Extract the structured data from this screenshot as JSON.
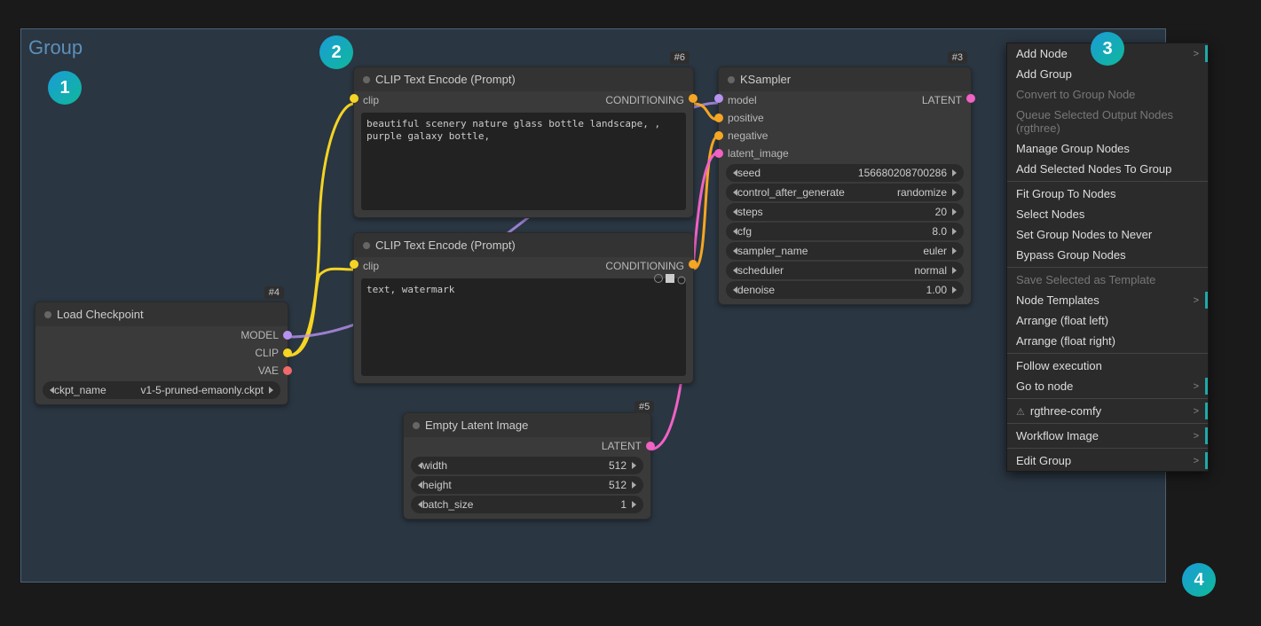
{
  "group": {
    "title": "Group"
  },
  "nodes": {
    "loadckpt": {
      "id": "#4",
      "title": "Load Checkpoint",
      "outputs": {
        "model": "MODEL",
        "clip": "CLIP",
        "vae": "VAE"
      },
      "widget": {
        "label": "ckpt_name",
        "value": "v1-5-pruned-emaonly.ckpt"
      }
    },
    "clip1": {
      "id": "#6",
      "title": "CLIP Text Encode (Prompt)",
      "in": "clip",
      "out": "CONDITIONING",
      "text": "beautiful scenery nature glass bottle landscape, , purple galaxy bottle,"
    },
    "clip2": {
      "id": "",
      "title": "CLIP Text Encode (Prompt)",
      "in": "clip",
      "out": "CONDITIONING",
      "text": "text, watermark"
    },
    "empty": {
      "id": "#5",
      "title": "Empty Latent Image",
      "out": "LATENT",
      "widgets": [
        {
          "label": "width",
          "value": "512"
        },
        {
          "label": "height",
          "value": "512"
        },
        {
          "label": "batch_size",
          "value": "1"
        }
      ]
    },
    "ksampler": {
      "id": "#3",
      "title": "KSampler",
      "ins": {
        "model": "model",
        "positive": "positive",
        "negative": "negative",
        "latent": "latent_image"
      },
      "out": "LATENT",
      "widgets": [
        {
          "label": "seed",
          "value": "156680208700286"
        },
        {
          "label": "control_after_generate",
          "value": "randomize"
        },
        {
          "label": "steps",
          "value": "20"
        },
        {
          "label": "cfg",
          "value": "8.0"
        },
        {
          "label": "sampler_name",
          "value": "euler"
        },
        {
          "label": "scheduler",
          "value": "normal"
        },
        {
          "label": "denoise",
          "value": "1.00"
        }
      ]
    }
  },
  "menu": {
    "items": [
      {
        "label": "Add Node",
        "sub": true,
        "accent": true
      },
      {
        "label": "Add Group"
      },
      {
        "label": "Convert to Group Node",
        "disabled": true
      },
      {
        "label": "Queue Selected Output Nodes (rgthree)",
        "disabled": true
      },
      {
        "label": "Manage Group Nodes"
      },
      {
        "label": "Add Selected Nodes To Group"
      },
      {
        "sep": true
      },
      {
        "label": "Fit Group To Nodes"
      },
      {
        "label": "Select Nodes"
      },
      {
        "label": "Set Group Nodes to Never"
      },
      {
        "label": "Bypass Group Nodes"
      },
      {
        "sep": true
      },
      {
        "label": "Save Selected as Template",
        "disabled": true
      },
      {
        "label": "Node Templates",
        "sub": true,
        "accent": true
      },
      {
        "label": "Arrange (float left)"
      },
      {
        "label": "Arrange (float right)"
      },
      {
        "sep": true
      },
      {
        "label": "Follow execution"
      },
      {
        "label": "Go to node",
        "sub": true,
        "accent": true
      },
      {
        "sep": true
      },
      {
        "label": "rgthree-comfy",
        "sub": true,
        "accent": true,
        "icon": true
      },
      {
        "sep": true
      },
      {
        "label": "Workflow Image",
        "sub": true,
        "accent": true
      },
      {
        "sep": true
      },
      {
        "label": "Edit Group",
        "sub": true,
        "accent": true
      }
    ]
  },
  "steps": {
    "s1": "1",
    "s2": "2",
    "s3": "3",
    "s4": "4"
  },
  "colors": {
    "orange": "#f5a623",
    "clip": "#f5d423",
    "model": "#b892f0",
    "vae": "#f06a6a",
    "latent": "#f062c4"
  }
}
